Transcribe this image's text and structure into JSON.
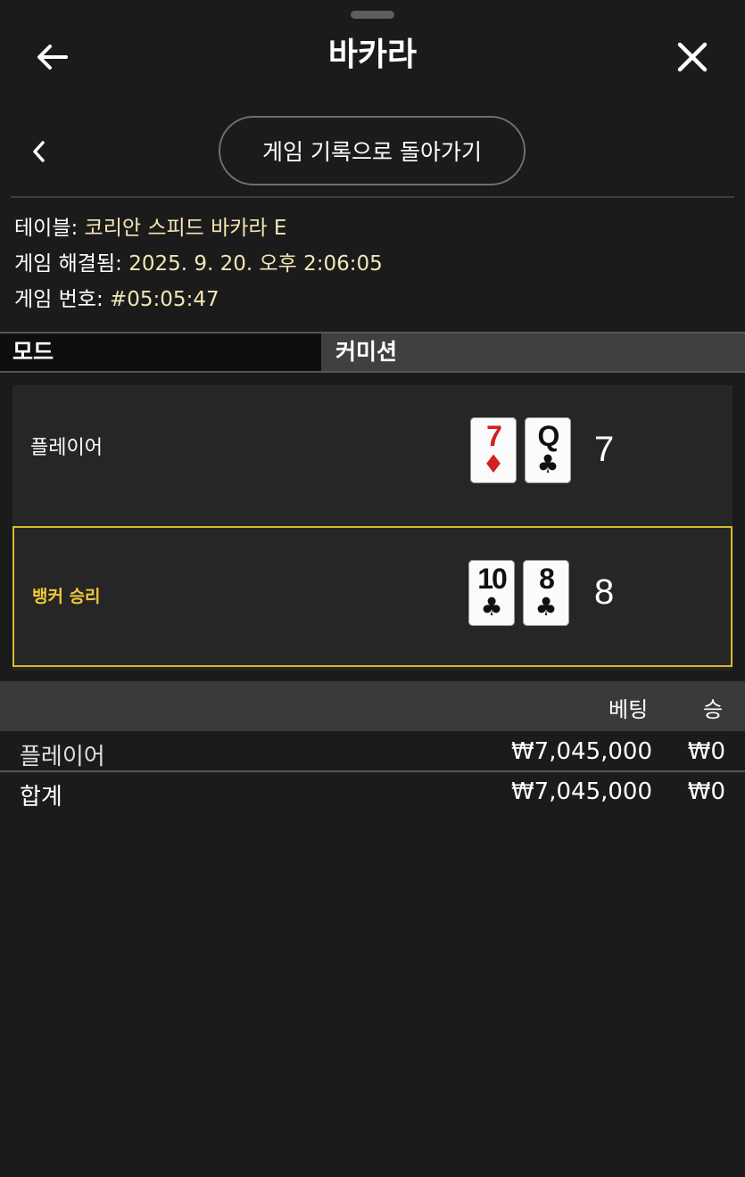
{
  "header": {
    "title": "바카라",
    "back_icon": "arrow-left-icon",
    "close_icon": "close-icon"
  },
  "nav": {
    "back_icon": "chevron-left-icon",
    "return_label": "게임 기록으로 돌아가기"
  },
  "info": {
    "table_label": "테이블:",
    "table_value": "코리안 스피드 바카라 E",
    "settled_label": "게임 해결됨:",
    "settled_value": "2025. 9. 20. 오후 2:06:05",
    "number_label": "게임 번호:",
    "number_value": "#05:05:47"
  },
  "mode": {
    "label": "모드",
    "value": "커미션"
  },
  "result": {
    "player": {
      "label": "플레이어",
      "score": "7",
      "cards": [
        {
          "rank": "7",
          "suit": "♦",
          "suit_name": "diamonds",
          "color": "#d21f1f"
        },
        {
          "rank": "Q",
          "suit": "♣",
          "suit_name": "clubs",
          "color": "#111111"
        }
      ]
    },
    "banker": {
      "label": "뱅커 승리",
      "score": "8",
      "cards": [
        {
          "rank": "10",
          "suit": "♣",
          "suit_name": "clubs",
          "color": "#111111"
        },
        {
          "rank": "8",
          "suit": "♣",
          "suit_name": "clubs",
          "color": "#111111"
        }
      ]
    }
  },
  "bets": {
    "headers": {
      "bet": "베팅",
      "win": "승"
    },
    "rows": [
      {
        "name": "플레이어",
        "bet": "₩7,045,000",
        "win": "₩0"
      }
    ],
    "total": {
      "name": "합계",
      "bet": "₩7,045,000",
      "win": "₩0"
    }
  },
  "colors": {
    "background": "#1b1b1b",
    "accent_gold": "#d8b92a",
    "info_value": "#f3e6b4",
    "banker_label": "#f2c83a"
  }
}
